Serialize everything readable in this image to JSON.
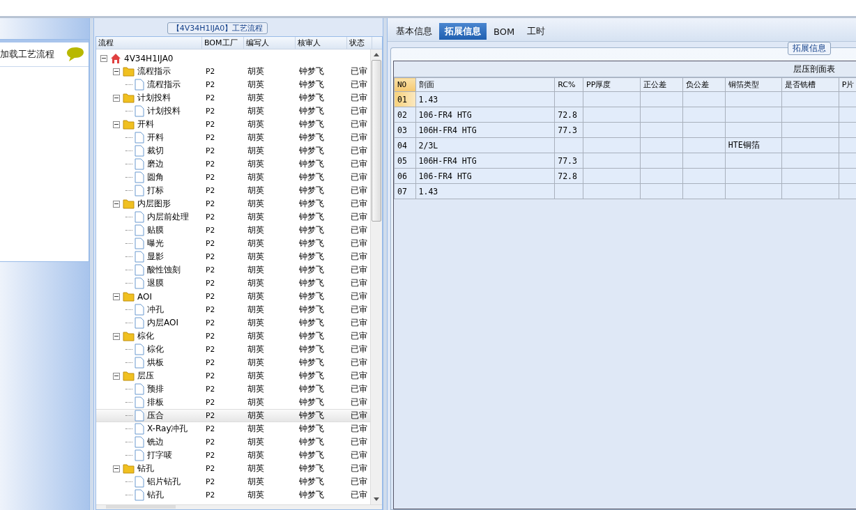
{
  "left_panel": {
    "action": "加载工艺流程"
  },
  "flow_panel": {
    "title": "【4V34H1IJA0】工艺流程",
    "columns": [
      "流程",
      "BOM工厂",
      "编写人",
      "核审人",
      "状态"
    ],
    "tree": [
      {
        "name": "4V34H1IJA0",
        "kind": "root",
        "expanded": true,
        "selected": false,
        "children": [
          {
            "name": "流程指示",
            "kind": "folder",
            "bom": "P2",
            "writer": "胡英",
            "reviewer": "钟梦飞",
            "status": "已审",
            "expanded": true,
            "selected": false,
            "children": [
              {
                "name": "流程指示",
                "kind": "step",
                "bom": "P2",
                "writer": "胡英",
                "reviewer": "钟梦飞",
                "status": "已审",
                "selected": false
              }
            ]
          },
          {
            "name": "计划投料",
            "kind": "folder",
            "bom": "P2",
            "writer": "胡英",
            "reviewer": "钟梦飞",
            "status": "已审",
            "expanded": true,
            "selected": false,
            "children": [
              {
                "name": "计划投料",
                "kind": "step",
                "bom": "P2",
                "writer": "胡英",
                "reviewer": "钟梦飞",
                "status": "已审",
                "selected": false
              }
            ]
          },
          {
            "name": "开料",
            "kind": "folder",
            "bom": "P2",
            "writer": "胡英",
            "reviewer": "钟梦飞",
            "status": "已审",
            "expanded": true,
            "selected": false,
            "children": [
              {
                "name": "开料",
                "kind": "step",
                "bom": "P2",
                "writer": "胡英",
                "reviewer": "钟梦飞",
                "status": "已审",
                "selected": false
              },
              {
                "name": "裁切",
                "kind": "step",
                "bom": "P2",
                "writer": "胡英",
                "reviewer": "钟梦飞",
                "status": "已审",
                "selected": false
              },
              {
                "name": "磨边",
                "kind": "step",
                "bom": "P2",
                "writer": "胡英",
                "reviewer": "钟梦飞",
                "status": "已审",
                "selected": false
              },
              {
                "name": "圆角",
                "kind": "step",
                "bom": "P2",
                "writer": "胡英",
                "reviewer": "钟梦飞",
                "status": "已审",
                "selected": false
              },
              {
                "name": "打标",
                "kind": "step",
                "bom": "P2",
                "writer": "胡英",
                "reviewer": "钟梦飞",
                "status": "已审",
                "selected": false
              }
            ]
          },
          {
            "name": "内层图形",
            "kind": "folder",
            "bom": "P2",
            "writer": "胡英",
            "reviewer": "钟梦飞",
            "status": "已审",
            "expanded": true,
            "selected": false,
            "children": [
              {
                "name": "内层前处理",
                "kind": "step",
                "bom": "P2",
                "writer": "胡英",
                "reviewer": "钟梦飞",
                "status": "已审",
                "selected": false
              },
              {
                "name": "贴膜",
                "kind": "step",
                "bom": "P2",
                "writer": "胡英",
                "reviewer": "钟梦飞",
                "status": "已审",
                "selected": false
              },
              {
                "name": "曝光",
                "kind": "step",
                "bom": "P2",
                "writer": "胡英",
                "reviewer": "钟梦飞",
                "status": "已审",
                "selected": false
              },
              {
                "name": "显影",
                "kind": "step",
                "bom": "P2",
                "writer": "胡英",
                "reviewer": "钟梦飞",
                "status": "已审",
                "selected": false
              },
              {
                "name": "酸性蚀刻",
                "kind": "step",
                "bom": "P2",
                "writer": "胡英",
                "reviewer": "钟梦飞",
                "status": "已审",
                "selected": false
              },
              {
                "name": "退膜",
                "kind": "step",
                "bom": "P2",
                "writer": "胡英",
                "reviewer": "钟梦飞",
                "status": "已审",
                "selected": false
              }
            ]
          },
          {
            "name": "AOI",
            "kind": "folder",
            "bom": "P2",
            "writer": "胡英",
            "reviewer": "钟梦飞",
            "status": "已审",
            "expanded": true,
            "selected": false,
            "children": [
              {
                "name": "冲孔",
                "kind": "step",
                "bom": "P2",
                "writer": "胡英",
                "reviewer": "钟梦飞",
                "status": "已审",
                "selected": false
              },
              {
                "name": "内层AOI",
                "kind": "step",
                "bom": "P2",
                "writer": "胡英",
                "reviewer": "钟梦飞",
                "status": "已审",
                "selected": false
              }
            ]
          },
          {
            "name": "棕化",
            "kind": "folder",
            "bom": "P2",
            "writer": "胡英",
            "reviewer": "钟梦飞",
            "status": "已审",
            "expanded": true,
            "selected": false,
            "children": [
              {
                "name": "棕化",
                "kind": "step",
                "bom": "P2",
                "writer": "胡英",
                "reviewer": "钟梦飞",
                "status": "已审",
                "selected": false
              },
              {
                "name": "烘板",
                "kind": "step",
                "bom": "P2",
                "writer": "胡英",
                "reviewer": "钟梦飞",
                "status": "已审",
                "selected": false
              }
            ]
          },
          {
            "name": "层压",
            "kind": "folder",
            "bom": "P2",
            "writer": "胡英",
            "reviewer": "钟梦飞",
            "status": "已审",
            "expanded": true,
            "selected": false,
            "children": [
              {
                "name": "预排",
                "kind": "step",
                "bom": "P2",
                "writer": "胡英",
                "reviewer": "钟梦飞",
                "status": "已审",
                "selected": false
              },
              {
                "name": "排板",
                "kind": "step",
                "bom": "P2",
                "writer": "胡英",
                "reviewer": "钟梦飞",
                "status": "已审",
                "selected": false
              },
              {
                "name": "压合",
                "kind": "step",
                "bom": "P2",
                "writer": "胡英",
                "reviewer": "钟梦飞",
                "status": "已审",
                "selected": true
              },
              {
                "name": "X-Ray冲孔",
                "kind": "step",
                "bom": "P2",
                "writer": "胡英",
                "reviewer": "钟梦飞",
                "status": "已审",
                "selected": false
              },
              {
                "name": "铣边",
                "kind": "step",
                "bom": "P2",
                "writer": "胡英",
                "reviewer": "钟梦飞",
                "status": "已审",
                "selected": false
              },
              {
                "name": "打字唛",
                "kind": "step",
                "bom": "P2",
                "writer": "胡英",
                "reviewer": "钟梦飞",
                "status": "已审",
                "selected": false
              }
            ]
          },
          {
            "name": "钻孔",
            "kind": "folder",
            "bom": "P2",
            "writer": "胡英",
            "reviewer": "钟梦飞",
            "status": "已审",
            "expanded": true,
            "selected": false,
            "children": [
              {
                "name": "铝片钻孔",
                "kind": "step",
                "bom": "P2",
                "writer": "胡英",
                "reviewer": "钟梦飞",
                "status": "已审",
                "selected": false
              },
              {
                "name": "钻孔",
                "kind": "step",
                "bom": "P2",
                "writer": "胡英",
                "reviewer": "钟梦飞",
                "status": "已审",
                "selected": false
              }
            ]
          }
        ]
      }
    ]
  },
  "tabs": [
    {
      "label": "基本信息",
      "selected": false
    },
    {
      "label": "拓展信息",
      "selected": true
    },
    {
      "label": "BOM",
      "selected": false
    },
    {
      "label": "工时",
      "selected": false
    }
  ],
  "extended_info": {
    "legend": "拓展信息",
    "table_title": "层压剖面表",
    "columns": [
      "NO",
      "剖面",
      "RC%",
      "PP厚度",
      "正公差",
      "负公差",
      "铜箔类型",
      "是否铣槽",
      "P片"
    ],
    "rows": [
      {
        "cells": [
          "01",
          "1.43",
          "",
          "",
          "",
          "",
          "",
          "",
          ""
        ],
        "selected": true
      },
      {
        "cells": [
          "02",
          "106-FR4 HTG",
          "72.8",
          "",
          "",
          "",
          "",
          "",
          ""
        ],
        "selected": false
      },
      {
        "cells": [
          "03",
          "106H-FR4 HTG",
          "77.3",
          "",
          "",
          "",
          "",
          "",
          ""
        ],
        "selected": false
      },
      {
        "cells": [
          "04",
          "2/3L",
          "",
          "",
          "",
          "",
          "HTE铜箔",
          "",
          ""
        ],
        "selected": false
      },
      {
        "cells": [
          "05",
          "106H-FR4 HTG",
          "77.3",
          "",
          "",
          "",
          "",
          "",
          ""
        ],
        "selected": false
      },
      {
        "cells": [
          "06",
          "106-FR4 HTG",
          "72.8",
          "",
          "",
          "",
          "",
          "",
          ""
        ],
        "selected": false
      },
      {
        "cells": [
          "07",
          "1.43",
          "",
          "",
          "",
          "",
          "",
          "",
          ""
        ],
        "selected": false
      }
    ]
  }
}
